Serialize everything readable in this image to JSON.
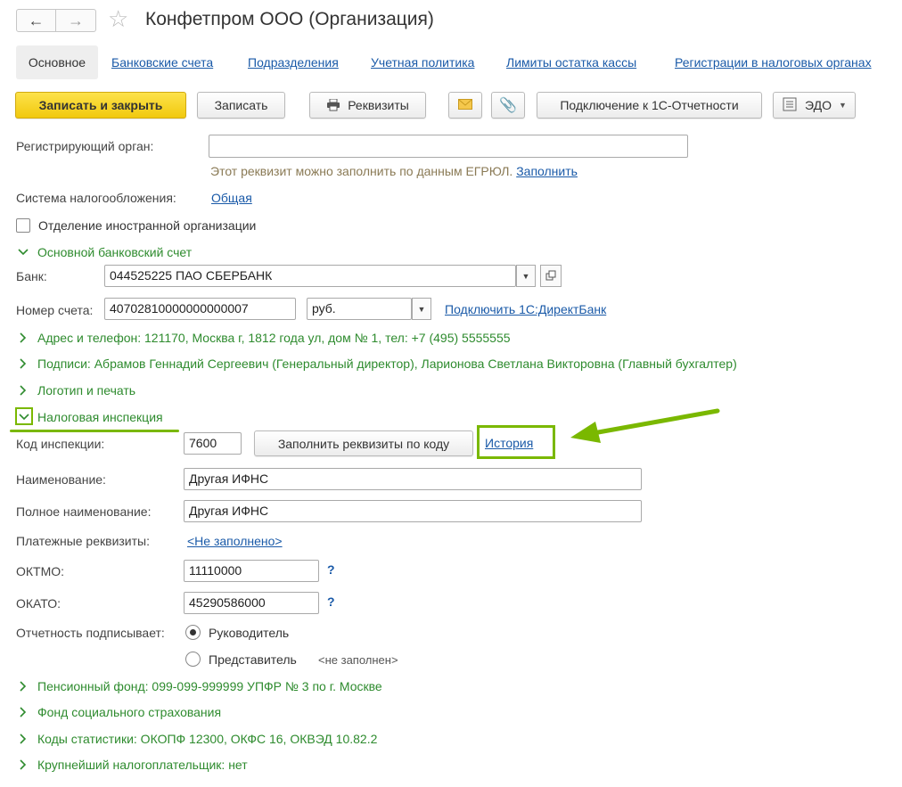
{
  "window": {
    "title": "Конфетпром ООО (Организация)"
  },
  "tabs": [
    "Основное",
    "Банковские счета",
    "Подразделения",
    "Учетная политика",
    "Лимиты остатка кассы",
    "Регистрации в налоговых органах"
  ],
  "toolbar": {
    "save_close": "Записать и закрыть",
    "save": "Записать",
    "details": "Реквизиты",
    "connect_reporting": "Подключение к 1С-Отчетности",
    "edo": "ЭДО"
  },
  "registering_body": {
    "label": "Регистрирующий орган:",
    "value": "",
    "hint": "Этот реквизит можно заполнить по данным ЕГРЮЛ.",
    "fill_link": "Заполнить"
  },
  "tax_system": {
    "label": "Система налогообложения:",
    "value": "Общая"
  },
  "foreign_branch": {
    "label": "Отделение иностранной организации",
    "checked": false
  },
  "bank_section": {
    "title": "Основной банковский счет",
    "bank_label": "Банк:",
    "bank_value": "044525225 ПАО СБЕРБАНК",
    "account_label": "Номер счета:",
    "account_value": "40702810000000000007",
    "currency": "руб.",
    "directbank_link": "Подключить 1С:ДиректБанк"
  },
  "collapsed_sections": {
    "address": "Адрес и телефон: 121170, Москва г, 1812 года ул, дом № 1, тел: +7 (495) 5555555",
    "signatures": "Подписи: Абрамов Геннадий Сергеевич (Генеральный директор), Ларионова Светлана Викторовна (Главный бухгалтер)",
    "logo": "Логотип и печать"
  },
  "tax_inspection": {
    "title": "Налоговая инспекция",
    "code_label": "Код инспекции:",
    "code_value": "7600",
    "fill_by_code": "Заполнить реквизиты по коду",
    "history_link": "История",
    "name_label": "Наименование:",
    "name_value": "Другая ИФНС",
    "full_name_label": "Полное наименование:",
    "full_name_value": "Другая ИФНС",
    "payment_label": "Платежные реквизиты:",
    "payment_value": "<Не заполнено>",
    "oktmo_label": "ОКТМО:",
    "oktmo_value": "11110000",
    "okato_label": "ОКАТО:",
    "okato_value": "45290586000",
    "help_mark": "?",
    "signer_label": "Отчетность подписывает:",
    "signer_head": "Руководитель",
    "signer_rep": "Представитель",
    "signer_rep_value": "<не заполнен>",
    "selected": "head"
  },
  "bottom_sections": {
    "pension": "Пенсионный фонд: 099-099-999999 УПФР № 3 по г. Москве",
    "social": "Фонд социального страхования",
    "stats": "Коды статистики: ОКОПФ 12300, ОКФС 16, ОКВЭД 10.82.2",
    "largest": "Крупнейший налогоплательщик: нет"
  },
  "colors": {
    "accent_green": "#7ab800",
    "section_green": "#2e8b2e",
    "link_blue": "#1a5aa8",
    "primary_yellow": "#f6d21c"
  }
}
